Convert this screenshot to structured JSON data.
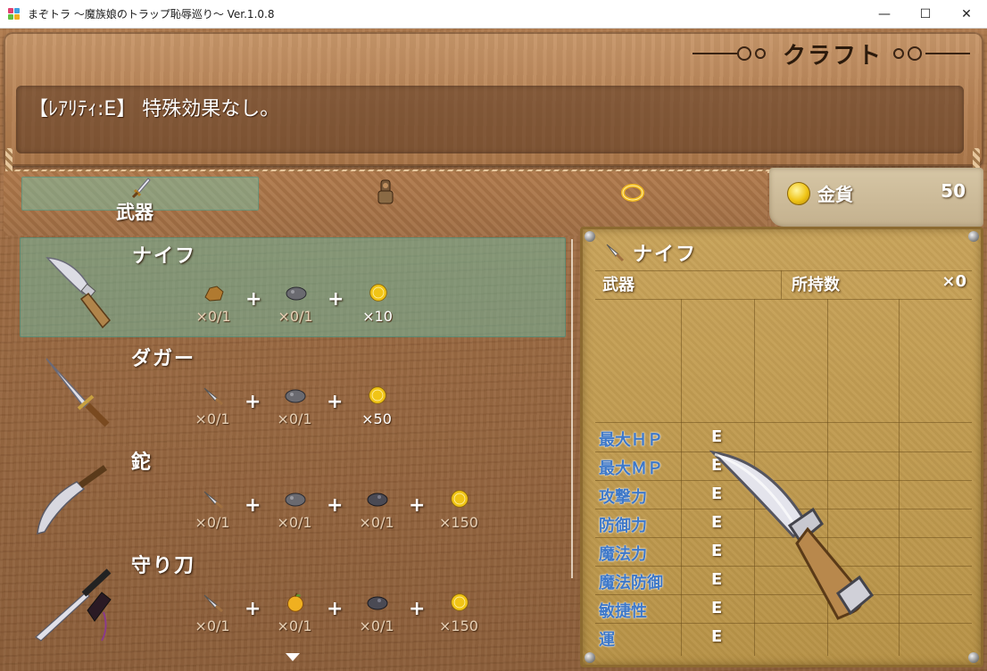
{
  "window": {
    "title": "まぞトラ ～魔族娘のトラップ恥辱巡り～ Ver.1.0.8",
    "minimize": "—",
    "maximize": "☐",
    "close": "✕"
  },
  "scene": {
    "title": "クラフト"
  },
  "help": {
    "text": "【ﾚｱﾘﾃｨ:E】 特殊効果なし。"
  },
  "category": {
    "selected_label": "武器",
    "icons": [
      "sword-icon",
      "armor-icon",
      "ring-icon"
    ]
  },
  "gold": {
    "label": "金貨",
    "value": "50"
  },
  "recipes": [
    {
      "name": "ナイフ",
      "selected": true,
      "materials": [
        {
          "icon": "ore-icon",
          "qty": "×0/1"
        },
        {
          "icon": "stone-icon",
          "qty": "×0/1"
        },
        {
          "icon": "gold-coin-icon",
          "qty": "×10"
        }
      ]
    },
    {
      "name": "ダガー",
      "selected": false,
      "materials": [
        {
          "icon": "knife-icon",
          "qty": "×0/1"
        },
        {
          "icon": "stone-icon",
          "qty": "×0/1"
        },
        {
          "icon": "gold-coin-icon",
          "qty": "×50"
        }
      ]
    },
    {
      "name": "鉈",
      "selected": false,
      "materials": [
        {
          "icon": "knife-icon",
          "qty": "×0/1"
        },
        {
          "icon": "stone-icon",
          "qty": "×0/1"
        },
        {
          "icon": "dark-stone-icon",
          "qty": "×0/1"
        },
        {
          "icon": "gold-coin-icon",
          "qty": "×150"
        }
      ]
    },
    {
      "name": "守り刀",
      "selected": false,
      "materials": [
        {
          "icon": "knife-icon",
          "qty": "×0/1"
        },
        {
          "icon": "apple-icon",
          "qty": "×0/1"
        },
        {
          "icon": "dark-stone-icon",
          "qty": "×0/1"
        },
        {
          "icon": "gold-coin-icon",
          "qty": "×150"
        }
      ]
    }
  ],
  "detail": {
    "title": "ナイフ",
    "category": "武器",
    "owned_label": "所持数",
    "owned_value": "×0",
    "stats": [
      {
        "label": "最大ＨＰ",
        "value": "E"
      },
      {
        "label": "最大ＭＰ",
        "value": "E"
      },
      {
        "label": "攻撃力",
        "value": "E"
      },
      {
        "label": "防御力",
        "value": "E"
      },
      {
        "label": "魔法力",
        "value": "E"
      },
      {
        "label": "魔法防御",
        "value": "E"
      },
      {
        "label": "敏捷性",
        "value": "E"
      },
      {
        "label": "運",
        "value": "E"
      }
    ]
  },
  "colors": {
    "wood": "#a06e44",
    "highlight": "#78c3aa",
    "stat_label": "#3e78c8",
    "gold": "#f0c416"
  }
}
